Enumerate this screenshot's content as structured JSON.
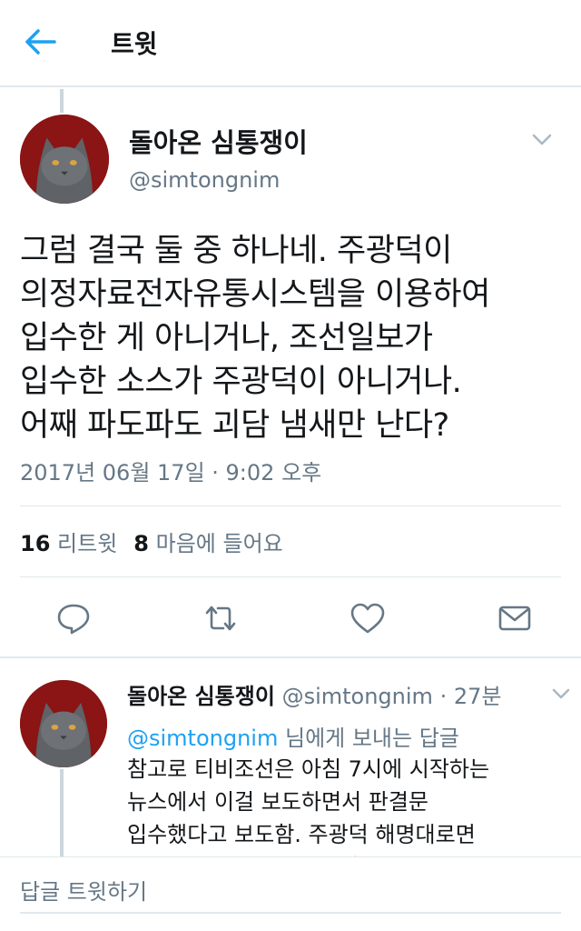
{
  "header": {
    "title": "트윗"
  },
  "tweet": {
    "author_name": "돌아온 심통쟁이",
    "author_handle": "@simtongnim",
    "text": "그럼 결국 둘 중 하나네. 주광덕이\n의정자료전자유통시스템을 이용하여\n입수한 게 아니거나, 조선일보가\n입수한 소스가 주광덕이 아니거나.\n어째 파도파도 괴담 냄새만 난다?",
    "timestamp": "2017년 06월 17일 · 9:02 오후",
    "retweet_count": "16",
    "retweet_label": "리트윗",
    "like_count": "8",
    "like_label": "마음에 들어요"
  },
  "reply": {
    "author_name": "돌아온 심통쟁이",
    "author_handle": "@simtongnim",
    "time": "· 27분",
    "mention": "@simtongnim",
    "replying_suffix": " 님에게 보내는 답글",
    "text": "참고로 티비조선은 아침 7시에 시작하는\n뉴스에서 이걸 보도하면서 판결문\n입수했다고 보도함. 주광덕 해명대로면\n두가지의 자료를 받아 실험이 다소 다르고"
  },
  "compose": {
    "placeholder": "답글 트윗하기"
  },
  "icons": {
    "back": "arrow-left-icon",
    "menu": "chevron-down-icon",
    "reply": "speech-bubble-icon",
    "retweet": "retweet-icon",
    "like": "heart-icon",
    "dm": "envelope-icon"
  },
  "colors": {
    "accent": "#1da1f2",
    "secondary_text": "#657786",
    "divider": "#e1e8ed"
  }
}
